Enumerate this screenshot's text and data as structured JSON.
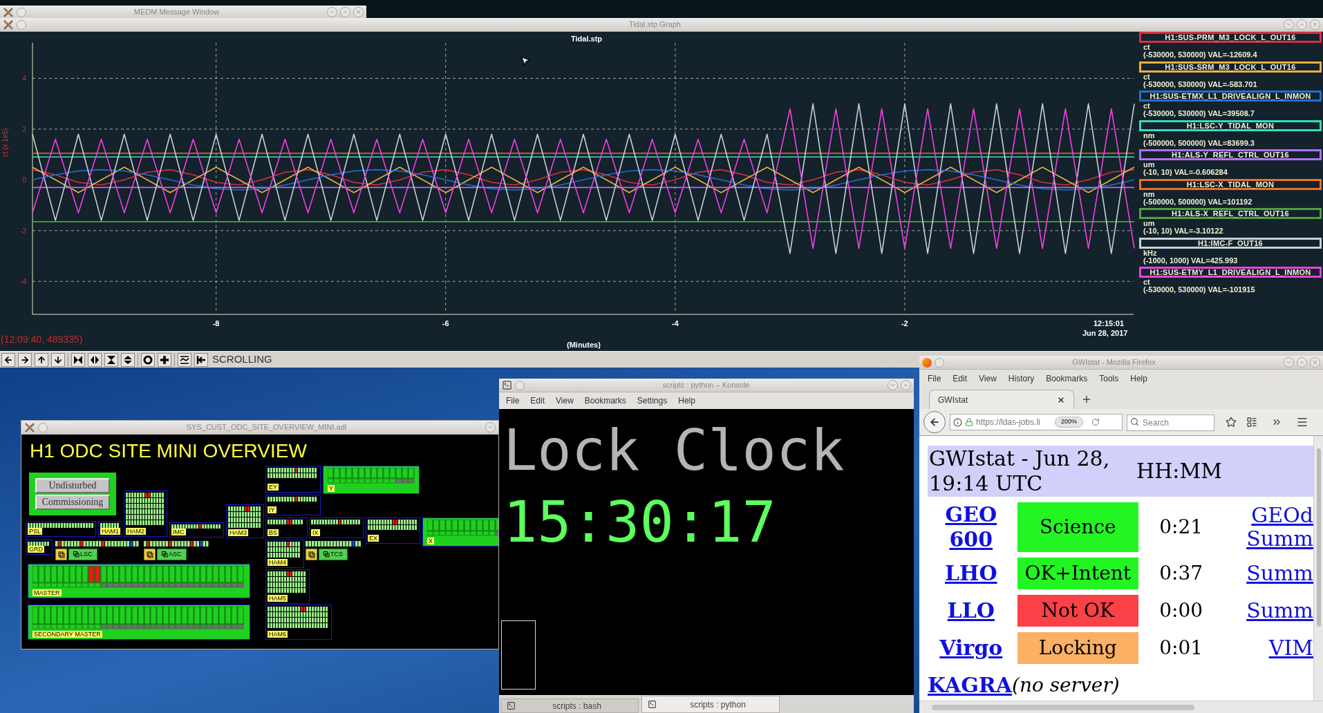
{
  "message_window": {
    "title": "MEDM Message Window"
  },
  "graph_window": {
    "title": "Tidal.stp Graph",
    "plot": {
      "end_time": "12:15:01",
      "end_date": "Jun 28, 2017",
      "cursor_readout": "(12:09:40, 489335)",
      "chart_data": {
        "type": "line",
        "title": "Tidal.stp",
        "xlabel": "(Minutes)",
        "ylabel": "ct (x 1e5)",
        "xlim": [
          -9.6,
          0
        ],
        "ylim": [
          -5.3,
          5.4
        ],
        "xticks": [
          -8,
          -6,
          -4,
          -2
        ],
        "yticks": [
          4,
          2,
          0,
          -2,
          -4
        ],
        "x": [
          -9.6,
          -9.4,
          -9.2,
          -9.0,
          -8.8,
          -8.6,
          -8.4,
          -8.2,
          -8.0,
          -7.8,
          -7.6,
          -7.4,
          -7.2,
          -7.0,
          -6.8,
          -6.6,
          -6.4,
          -6.2,
          -6.0,
          -5.8,
          -5.6,
          -5.4,
          -5.2,
          -5.0,
          -4.8,
          -4.6,
          -4.4,
          -4.2,
          -4.0,
          -3.8,
          -3.6,
          -3.4,
          -3.2,
          -3.0,
          -2.8,
          -2.6,
          -2.4,
          -2.2,
          -2.0,
          -1.8,
          -1.6,
          -1.4,
          -1.2,
          -1.0,
          -0.8,
          -0.6,
          -0.4,
          -0.2,
          0
        ],
        "series": [
          {
            "name": "H1:SUS-PRM_M3_LOCK_L_OUT16",
            "color": "#d83040",
            "values": [
              0.4,
              0.2,
              -0.1,
              -0.2,
              0,
              0.3,
              0.4,
              0.2,
              -0.1,
              -0.2,
              0,
              0.3,
              0.4,
              0.2,
              -0.1,
              -0.2,
              0,
              0.3,
              0.4,
              0.2,
              -0.1,
              -0.2,
              0,
              0.3,
              0.4,
              0.2,
              -0.1,
              -0.2,
              0,
              0.3,
              0.4,
              0.2,
              -0.1,
              -0.2,
              0,
              0.3,
              0.4,
              0.2,
              -0.1,
              -0.2,
              0,
              0.3,
              0.4,
              0.2,
              -0.1,
              -0.2,
              0,
              0.3,
              0.4
            ]
          },
          {
            "name": "H1:SUS-SRM_M3_LOCK_L_OUT16",
            "color": "#f0b040",
            "values": [
              0.5,
              0,
              -0.5,
              0,
              0.5,
              0,
              -0.5,
              0,
              0.5,
              0,
              -0.5,
              0,
              0.5,
              0,
              -0.5,
              0,
              0.5,
              0,
              -0.5,
              0,
              0.5,
              0,
              -0.5,
              0,
              0.5,
              0,
              -0.5,
              0,
              0.5,
              0,
              -0.5,
              0,
              0.5,
              0,
              -0.5,
              0,
              0.5,
              0,
              -0.5,
              0,
              0.5,
              0,
              -0.5,
              0,
              0.5,
              0,
              -0.5,
              0,
              0.5
            ]
          },
          {
            "name": "H1:SUS-ETMX_L1_DRIVEALIGN_L_INMON",
            "color": "#2070d0",
            "values": [
              0,
              0.2,
              0.35,
              0.4,
              0.35,
              0.2,
              0,
              -0.2,
              -0.35,
              -0.4,
              -0.35,
              -0.2,
              0,
              0.2,
              0.35,
              0.4,
              0.35,
              0.2,
              0,
              -0.2,
              -0.35,
              -0.4,
              -0.35,
              -0.2,
              0,
              0.2,
              0.35,
              0.4,
              0.35,
              0.2,
              0,
              -0.2,
              -0.35,
              -0.4,
              -0.35,
              -0.2,
              0,
              0.2,
              0.35,
              0.4,
              0.35,
              0.2,
              0,
              -0.2,
              -0.35,
              -0.4,
              -0.35,
              -0.2,
              0
            ]
          },
          {
            "name": "H1:LSC-Y_TIDAL_MON",
            "color": "#30e0c0",
            "values": [
              0.9,
              0.9,
              0.9,
              0.9,
              0.9,
              0.9,
              0.9,
              0.9,
              0.9,
              0.9,
              0.9,
              0.9,
              0.9,
              0.9,
              0.9,
              0.9,
              0.9,
              0.9,
              0.9,
              0.9,
              0.9,
              0.9,
              0.9,
              0.9,
              0.9,
              0.9,
              0.9,
              0.9,
              0.9,
              0.9,
              0.9,
              0.9,
              0.9,
              0.9,
              0.9,
              0.9,
              0.9,
              0.9,
              0.9,
              0.9,
              0.9,
              0.9,
              0.9,
              0.9,
              0.9,
              0.9,
              0.9,
              0.9,
              0.9
            ]
          },
          {
            "name": "H1:ALS-Y_REFL_CTRL_OUT16",
            "color": "#b070f0",
            "values": [
              -0.3,
              -0.3,
              -0.3,
              -0.3,
              -0.3,
              -0.3,
              -0.3,
              -0.3,
              -0.3,
              -0.3,
              -0.3,
              -0.3,
              -0.3,
              -0.3,
              -0.3,
              -0.3,
              -0.3,
              -0.3,
              -0.3,
              -0.3,
              -0.3,
              -0.3,
              -0.3,
              -0.3,
              -0.3,
              -0.3,
              -0.3,
              -0.3,
              -0.3,
              -0.3,
              -0.3,
              -0.3,
              -0.3,
              -0.3,
              -0.3,
              -0.3,
              -0.3,
              -0.3,
              -0.3,
              -0.3,
              -0.3,
              -0.3,
              -0.3,
              -0.3,
              -0.3,
              -0.3,
              -0.3,
              -0.3,
              -0.3
            ]
          },
          {
            "name": "H1:LSC-X_TIDAL_MON",
            "color": "#f07020",
            "values": [
              1.05,
              1.05,
              1.05,
              1.05,
              1.05,
              1.05,
              1.05,
              1.05,
              1.05,
              1.05,
              1.05,
              1.05,
              1.05,
              1.05,
              1.05,
              1.05,
              1.05,
              1.05,
              1.05,
              1.05,
              1.05,
              1.05,
              1.05,
              1.05,
              1.05,
              1.05,
              1.05,
              1.05,
              1.05,
              1.05,
              1.05,
              1.05,
              1.05,
              1.05,
              1.05,
              1.05,
              1.05,
              1.05,
              1.05,
              1.05,
              1.05,
              1.05,
              1.05,
              1.05,
              1.05,
              1.05,
              1.05,
              1.05,
              1.05
            ]
          },
          {
            "name": "H1:ALS-X_REFL_CTRL_OUT16",
            "color": "#50a040",
            "values": [
              -1.65,
              -1.65,
              -1.65,
              -1.65,
              -1.65,
              -1.65,
              -1.65,
              -1.65,
              -1.65,
              -1.65,
              -1.65,
              -1.65,
              -1.65,
              -1.65,
              -1.65,
              -1.65,
              -1.65,
              -1.65,
              -1.65,
              -1.65,
              -1.65,
              -1.65,
              -1.65,
              -1.65,
              -1.65,
              -1.65,
              -1.65,
              -1.65,
              -1.65,
              -1.65,
              -1.65,
              -1.65,
              -1.65,
              -1.65,
              -1.65,
              -1.65,
              -1.65,
              -1.65,
              -1.65,
              -1.65,
              -1.65,
              -1.65,
              -1.65,
              -1.65,
              -1.65,
              -1.65,
              -1.65,
              -1.65,
              -1.65
            ]
          },
          {
            "name": "H1:IMC-F_OUT16",
            "color": "#c8d0d8",
            "values": [
              1.8,
              -1.6,
              1.8,
              -1.6,
              1.8,
              -1.6,
              1.8,
              -1.6,
              1.8,
              -1.6,
              1.8,
              -1.6,
              1.8,
              -1.6,
              1.8,
              -1.6,
              1.8,
              -1.6,
              1.8,
              -1.6,
              1.8,
              -1.6,
              1.8,
              -1.6,
              1.8,
              -1.6,
              1.8,
              -1.6,
              1.8,
              -1.6,
              1.8,
              -1.6,
              1.8,
              -2.9,
              3.0,
              -2.9,
              3.0,
              -2.9,
              3.0,
              -2.9,
              3.0,
              -2.9,
              3.0,
              -2.9,
              3.0,
              -2.9,
              3.0,
              -2.9,
              3.0
            ]
          },
          {
            "name": "H1:SUS-ETMY_L1_DRIVEALIGN_L_INMON",
            "color": "#f040e0",
            "values": [
              -1.3,
              1.6,
              -1.3,
              1.6,
              -1.3,
              1.6,
              -1.3,
              1.6,
              -1.3,
              1.6,
              -1.3,
              1.6,
              -1.3,
              1.6,
              -1.3,
              1.6,
              -1.3,
              1.6,
              -1.3,
              1.6,
              -1.3,
              1.6,
              -1.3,
              1.6,
              -1.3,
              1.6,
              -1.3,
              1.6,
              -1.3,
              1.6,
              -1.3,
              1.6,
              -1.3,
              2.8,
              -2.7,
              2.8,
              -2.7,
              2.8,
              -2.7,
              2.8,
              -2.7,
              2.8,
              -2.7,
              2.8,
              -2.7,
              2.8,
              -2.7,
              2.8,
              -2.7
            ]
          }
        ]
      }
    },
    "legend": [
      {
        "unit": "ct",
        "range": "(-530000, 530000) VAL=-12609.4"
      },
      {
        "unit": "ct",
        "range": "(-530000, 530000) VAL=-583.701"
      },
      {
        "unit": "ct",
        "range": "(-530000, 530000) VAL=39508.7"
      },
      {
        "unit": "nm",
        "range": "(-500000, 500000) VAL=83699.3"
      },
      {
        "unit": "um",
        "range": "(-10, 10) VAL=-0.606284"
      },
      {
        "unit": "nm",
        "range": "(-500000, 500000) VAL=101192"
      },
      {
        "unit": "um",
        "range": "(-10, 10) VAL=-3.10122"
      },
      {
        "unit": "kHz",
        "range": "(-1000, 1000) VAL=425.993"
      },
      {
        "unit": "ct",
        "range": "(-530000, 530000) VAL=-101915"
      }
    ],
    "toolbar": {
      "mode": "SCROLLING"
    }
  },
  "odc_window": {
    "title": "SYS_CUST_ODC_SITE_OVERVIEW_MINI.adl",
    "heading": "H1 ODC SITE MINI OVERVIEW",
    "buttons": [
      "Undisturbed",
      "Commissioning"
    ],
    "blocks": [
      {
        "label": "PSL",
        "kind": "grid",
        "alarm": false
      },
      {
        "label": "HAM1",
        "kind": "grid",
        "alarm": false
      },
      {
        "label": "HAM2",
        "kind": "grid",
        "alarm": true
      },
      {
        "label": "IMC",
        "kind": "grid",
        "alarm": true
      },
      {
        "label": "HAM3",
        "kind": "grid",
        "alarm": true
      },
      {
        "label": "EY",
        "kind": "grid",
        "alarm": true
      },
      {
        "label": "Y",
        "kind": "master",
        "alarm": false
      },
      {
        "label": "IY",
        "kind": "grid",
        "alarm": true
      },
      {
        "label": "BS",
        "kind": "grid",
        "alarm": true
      },
      {
        "label": "IX",
        "kind": "grid",
        "alarm": true
      },
      {
        "label": "EX",
        "kind": "grid",
        "alarm": true
      },
      {
        "label": "X",
        "kind": "master",
        "alarm": false
      },
      {
        "label": "GRD",
        "kind": "grid",
        "alarm": false
      },
      {
        "label": "LSC",
        "kind": "row",
        "alarm": true
      },
      {
        "label": "ASC",
        "kind": "row",
        "alarm": true
      },
      {
        "label": "HAM4",
        "kind": "grid",
        "alarm": true
      },
      {
        "label": "TCS",
        "kind": "row",
        "alarm": false
      },
      {
        "label": "MASTER",
        "kind": "master",
        "alarm": true
      },
      {
        "label": "HAM5",
        "kind": "grid",
        "alarm": true
      },
      {
        "label": "SECONDARY MASTER",
        "kind": "master",
        "alarm": false
      },
      {
        "label": "HAM6",
        "kind": "grid",
        "alarm": true
      }
    ]
  },
  "konsole": {
    "title": "scripts : python – Konsole",
    "menu": [
      "File",
      "Edit",
      "View",
      "Bookmarks",
      "Settings",
      "Help"
    ],
    "lines": [
      {
        "text": "Lock Clock",
        "kind": "heading"
      },
      {
        "text": "15:30:17",
        "kind": "clock"
      }
    ],
    "tabs": [
      {
        "label": "scripts : bash",
        "selected": false
      },
      {
        "label": "scripts : python",
        "selected": true
      }
    ]
  },
  "firefox": {
    "title": "GWIstat - Mozilla Firefox",
    "menu": [
      "File",
      "Edit",
      "View",
      "History",
      "Bookmarks",
      "Tools",
      "Help"
    ],
    "tabs": [
      {
        "label": "GWIstat",
        "selected": true
      }
    ],
    "url": "https://ldas-jobs.li",
    "zoom": "200%",
    "search": {
      "placeholder": "Search"
    },
    "page": {
      "heading": "GWIstat - Jun 28, 19:14 UTC",
      "heading_right": "HH:MM",
      "rows": [
        {
          "kind": "status",
          "site": "GEO 600",
          "status": "Science",
          "color": "#22f522",
          "time": "0:21",
          "link": "GEOd Summ"
        },
        {
          "kind": "status",
          "site": "LHO",
          "status": "OK+Intent",
          "color": "#22f522",
          "time": "0:37",
          "link": "Summ"
        },
        {
          "kind": "status",
          "site": "LLO",
          "status": "Not OK",
          "color": "#fc4048",
          "time": "0:00",
          "link": "Summ"
        },
        {
          "kind": "status",
          "site": "Virgo",
          "status": "Locking",
          "color": "#fcb064",
          "time": "0:01",
          "link": "VIM"
        },
        {
          "kind": "note",
          "site": "KAGRA",
          "note": "(no server)"
        }
      ]
    }
  }
}
